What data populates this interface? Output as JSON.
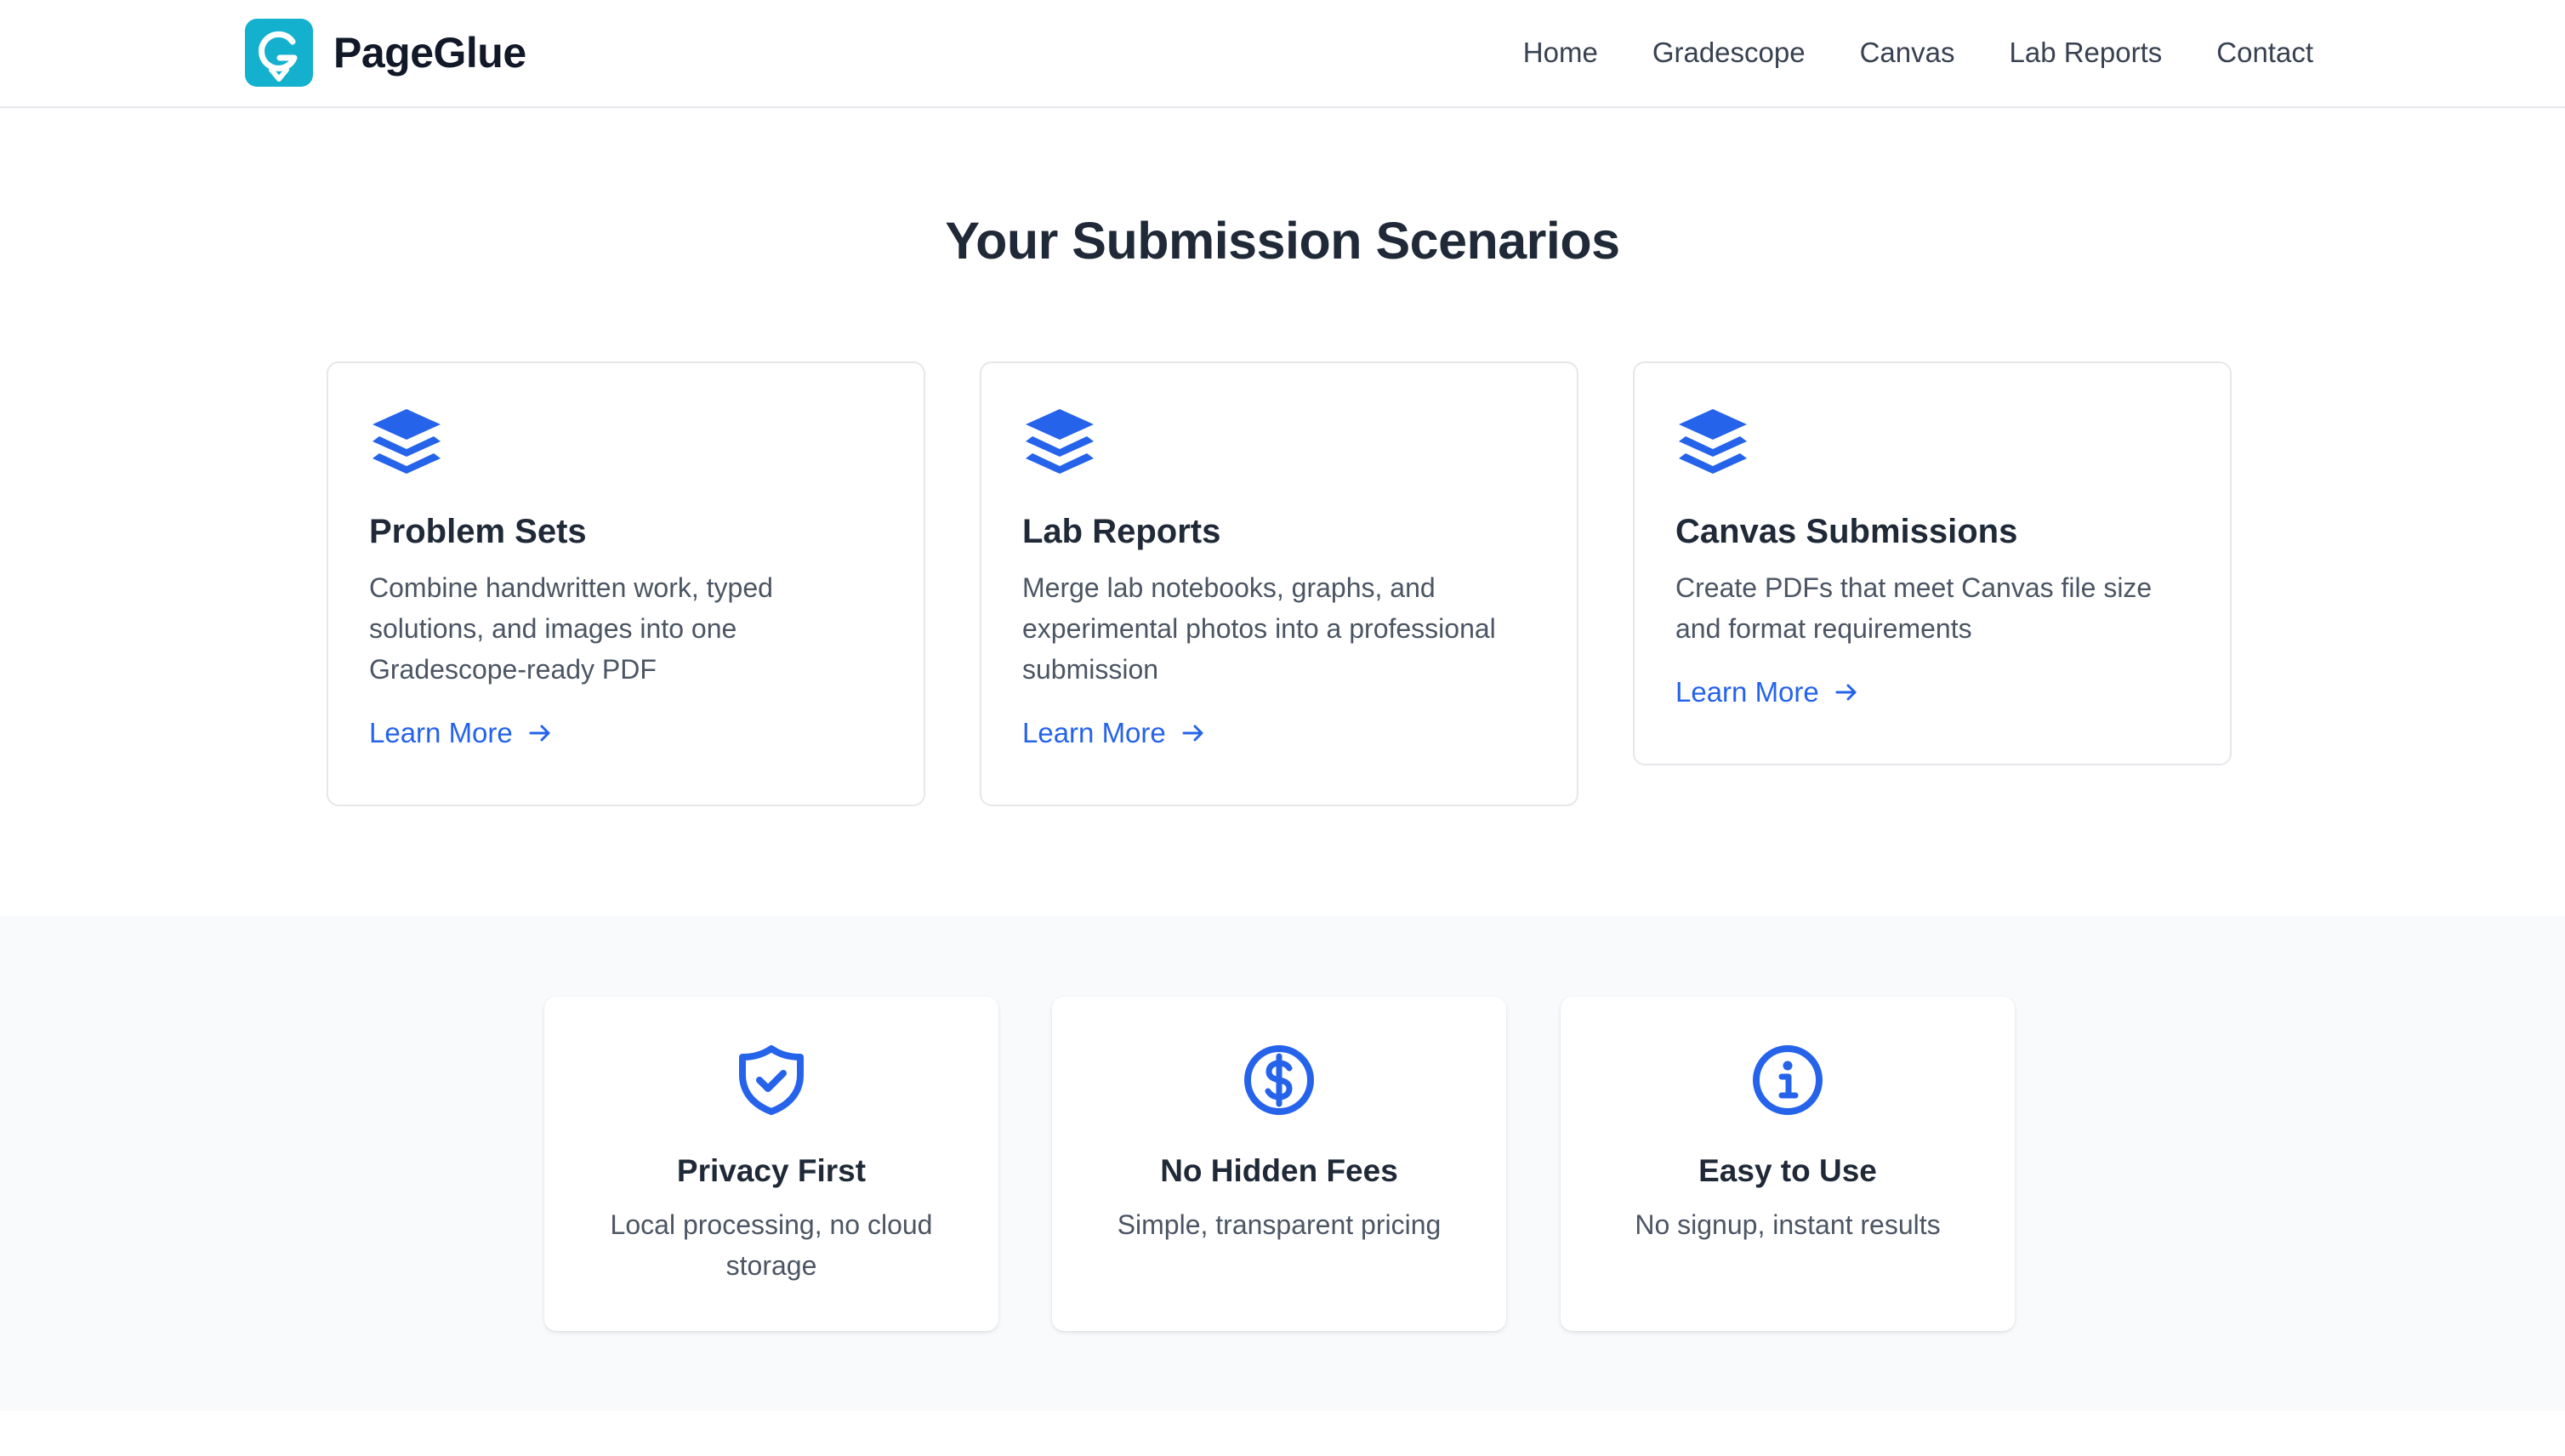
{
  "header": {
    "brand_name": "PageGlue",
    "nav": [
      "Home",
      "Gradescope",
      "Canvas",
      "Lab Reports",
      "Contact"
    ]
  },
  "scenarios": {
    "title": "Your Submission Scenarios",
    "cards": [
      {
        "title": "Problem Sets",
        "description": "Combine handwritten work, typed solutions, and images into one Gradescope-ready PDF",
        "link": "Learn More",
        "icon": "layers-icon"
      },
      {
        "title": "Lab Reports",
        "description": "Merge lab notebooks, graphs, and experimental photos into a professional submission",
        "link": "Learn More",
        "icon": "layers-icon"
      },
      {
        "title": "Canvas Submissions",
        "description": "Create PDFs that meet Canvas file size and format requirements",
        "link": "Learn More",
        "icon": "layers-icon"
      }
    ]
  },
  "features": [
    {
      "title": "Privacy First",
      "description": "Local processing, no cloud storage",
      "icon": "shield-check-icon"
    },
    {
      "title": "No Hidden Fees",
      "description": "Simple, transparent pricing",
      "icon": "dollar-circle-icon"
    },
    {
      "title": "Easy to Use",
      "description": "No signup, instant results",
      "icon": "info-circle-icon"
    }
  ],
  "colors": {
    "accent": "#2563eb",
    "logo": "#14b1cf",
    "heading": "#1f2937",
    "body_text": "#4b5563",
    "band_background": "#f8fafc"
  }
}
